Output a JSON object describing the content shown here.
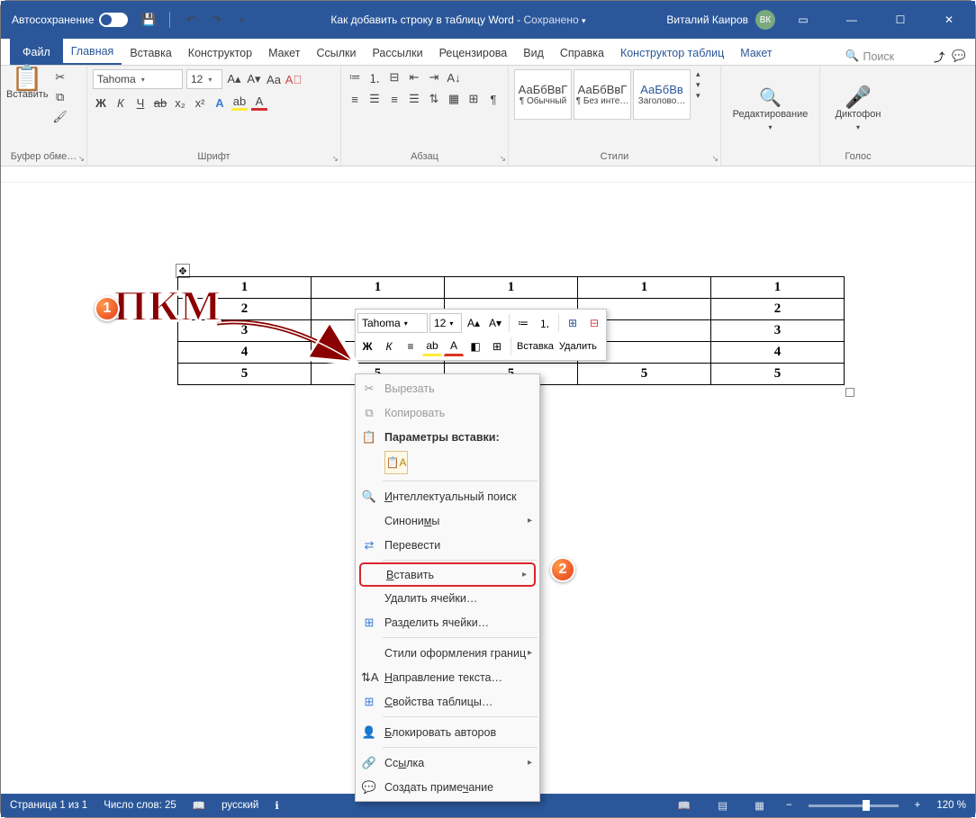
{
  "titlebar": {
    "autosave": "Автосохранение",
    "doc_title": "Как добавить строку в таблицу Word",
    "saved_status": "Сохранено",
    "user_name": "Виталий Каиров",
    "user_initials": "ВК"
  },
  "tabs": {
    "file": "Файл",
    "home": "Главная",
    "insert": "Вставка",
    "design": "Конструктор",
    "layout": "Макет",
    "references": "Ссылки",
    "mailings": "Рассылки",
    "review": "Рецензирова",
    "view": "Вид",
    "help": "Справка",
    "table_design": "Конструктор таблиц",
    "table_layout": "Макет",
    "search_placeholder": "Поиск"
  },
  "ribbon": {
    "clipboard": {
      "label": "Буфер обме…",
      "paste": "Вставить"
    },
    "font": {
      "label": "Шрифт",
      "name": "Tahoma",
      "size": "12",
      "bold": "Ж",
      "italic": "К",
      "underline": "Ч",
      "strike": "ab"
    },
    "paragraph": {
      "label": "Абзац"
    },
    "styles": {
      "label": "Стили",
      "items": [
        {
          "sample": "АаБбВвГ",
          "name": "¶ Обычный"
        },
        {
          "sample": "АаБбВвГ",
          "name": "¶ Без инте…"
        },
        {
          "sample": "АаБбВв",
          "name": "Заголово…"
        }
      ]
    },
    "editing": {
      "label": "Редактирование"
    },
    "voice": {
      "label": "Голос",
      "dictate": "Диктофон"
    }
  },
  "table": {
    "rows": [
      [
        "1",
        "1",
        "1",
        "1",
        "1"
      ],
      [
        "2",
        "",
        "",
        "",
        "2"
      ],
      [
        "3",
        "",
        "",
        "",
        "3"
      ],
      [
        "4",
        "",
        "",
        "",
        "4"
      ],
      [
        "5",
        "5",
        "5",
        "5",
        "5"
      ]
    ]
  },
  "mini_toolbar": {
    "font": "Tahoma",
    "size": "12",
    "bold": "Ж",
    "italic": "К",
    "insert": "Вставка",
    "delete": "Удалить"
  },
  "context_menu": {
    "cut": "Вырезать",
    "copy": "Копировать",
    "paste_options": "Параметры вставки:",
    "smart_lookup": "Интеллектуальный поиск",
    "synonyms": "Синонимы",
    "translate": "Перевести",
    "insert": "Вставить",
    "delete_cells": "Удалить ячейки…",
    "split_cells": "Разделить ячейки…",
    "border_styles": "Стили оформления границ",
    "text_direction": "Направление текста…",
    "table_properties": "Свойства таблицы…",
    "block_authors": "Блокировать авторов",
    "link": "Ссылка",
    "new_comment": "Создать примечание"
  },
  "annotations": {
    "badge1": "1",
    "badge2": "2",
    "pkm": "ПКМ"
  },
  "statusbar": {
    "page": "Страница 1 из 1",
    "words": "Число слов: 25",
    "language": "русский",
    "zoom": "120 %"
  }
}
